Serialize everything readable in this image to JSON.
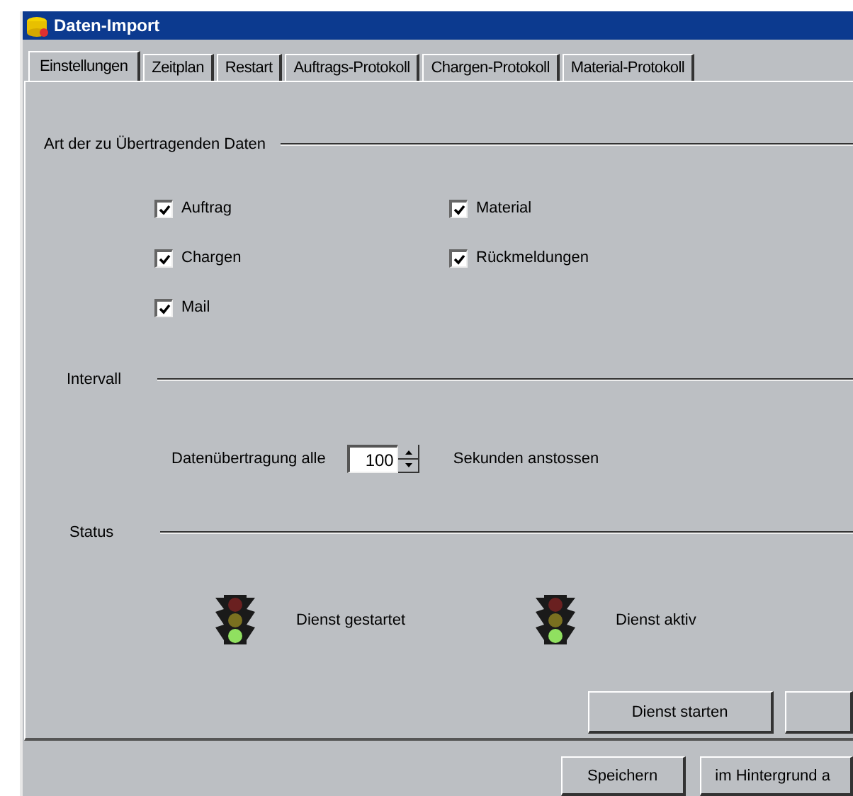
{
  "window": {
    "title": "Daten-Import"
  },
  "tabs": [
    {
      "label": "Einstellungen",
      "selected": true
    },
    {
      "label": "Zeitplan",
      "selected": false
    },
    {
      "label": "Restart",
      "selected": false
    },
    {
      "label": "Auftrags-Protokoll",
      "selected": false
    },
    {
      "label": "Chargen-Protokoll",
      "selected": false
    },
    {
      "label": "Material-Protokoll",
      "selected": false
    }
  ],
  "data_group": {
    "title": "Art der zu Übertragenden Daten",
    "options": [
      {
        "label": "Auftrag",
        "checked": true
      },
      {
        "label": "Material",
        "checked": true
      },
      {
        "label": "Chargen",
        "checked": true
      },
      {
        "label": "Rückmeldungen",
        "checked": true
      },
      {
        "label": "Mail",
        "checked": true
      }
    ]
  },
  "interval_group": {
    "title": "Intervall",
    "label": "Datenübertragung alle",
    "value": "100",
    "unit": "Sekunden anstossen"
  },
  "status_group": {
    "title": "Status",
    "indicators": [
      {
        "label": "Dienst gestartet",
        "red_on": false,
        "yellow_on": false,
        "green_on": true
      },
      {
        "label": "Dienst aktiv",
        "red_on": false,
        "yellow_on": false,
        "green_on": true
      }
    ]
  },
  "panel_buttons": [
    {
      "kind": "labeled",
      "label": "Dienst starten"
    },
    {
      "kind": "cut"
    }
  ],
  "footer_buttons": [
    {
      "label": "Speichern"
    },
    {
      "label": "im Hintergrund a"
    }
  ]
}
